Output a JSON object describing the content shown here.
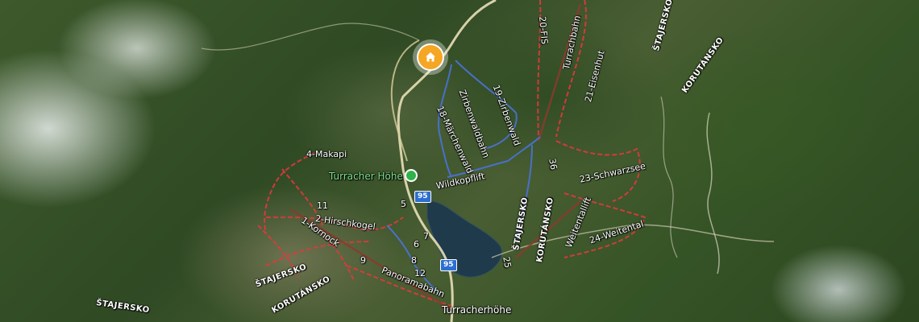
{
  "map": {
    "colors": {
      "piste_red": "#e0393e",
      "piste_blue": "#4a73d9",
      "lift": "#c0392b",
      "road": "#e8dfb8",
      "home_marker": "#f5a623",
      "place_pin": "#2fb34a",
      "route_shield": "#2d6fd0"
    },
    "home_marker_icon": "home-icon",
    "place_label": "Turracher Höhe",
    "village_label": "Turracherhöhe",
    "route_shields": [
      "95",
      "95"
    ],
    "region_labels": [
      "ŠTAJERSKO",
      "KORUTÁNSKO",
      "ŠTAJERSKO",
      "KORUTÁNSKO",
      "ŠTAJERSKO",
      "KORUTÁNSKO",
      "ŠTAJERSKO"
    ],
    "piste_labels": [
      "20-FIS",
      "Turrachbahn",
      "21-Eisenhut",
      "19-Zirbenwald",
      "Zirbenwaldbahn",
      "18-Märchenwald",
      "4-Makapi",
      "Wildkopflift",
      "23-Schwarzsee",
      "36",
      "11",
      "2-Hirschkogel",
      "1-Kornock",
      "5",
      "7",
      "6",
      "8",
      "9",
      "12",
      "Panoramabahn",
      "25",
      "Weitentallift",
      "24-Weitental"
    ]
  }
}
